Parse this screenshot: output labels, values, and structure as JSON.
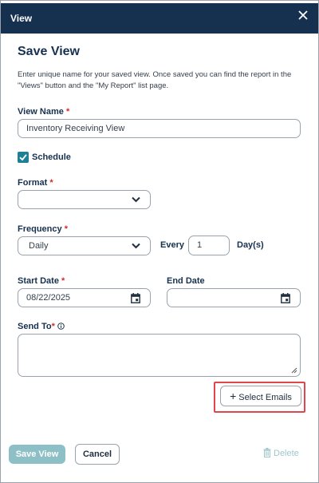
{
  "dialog": {
    "title": "View",
    "close_icon": "close-icon"
  },
  "form": {
    "heading": "Save View",
    "description": "Enter unique name for your saved view. Once saved you can find the report in the \"Views\" button and the \"My Report\" list page.",
    "view_name": {
      "label": "View Name",
      "required_mark": "*",
      "value": "Inventory Receiving View"
    },
    "schedule": {
      "label": "Schedule",
      "checked": true
    },
    "format": {
      "label": "Format",
      "required_mark": "*",
      "value": ""
    },
    "frequency": {
      "label": "Frequency",
      "required_mark": "*",
      "value": "Daily"
    },
    "every": {
      "label": "Every",
      "value": "1",
      "unit": "Day(s)"
    },
    "start_date": {
      "label": "Start Date",
      "required_mark": "*",
      "value": "08/22/2025"
    },
    "end_date": {
      "label": "End Date",
      "value": ""
    },
    "send_to": {
      "label": "Send To",
      "required_mark": "*",
      "info_icon": "info-icon",
      "value": ""
    },
    "select_emails_label": "Select Emails"
  },
  "footer": {
    "save_label": "Save View",
    "cancel_label": "Cancel",
    "delete_label": "Delete"
  },
  "colors": {
    "header_bg": "#16314f",
    "accent": "#1f7f95",
    "required": "#d22b2b",
    "highlight": "#e0474c",
    "save_disabled": "#8dbfc6"
  }
}
